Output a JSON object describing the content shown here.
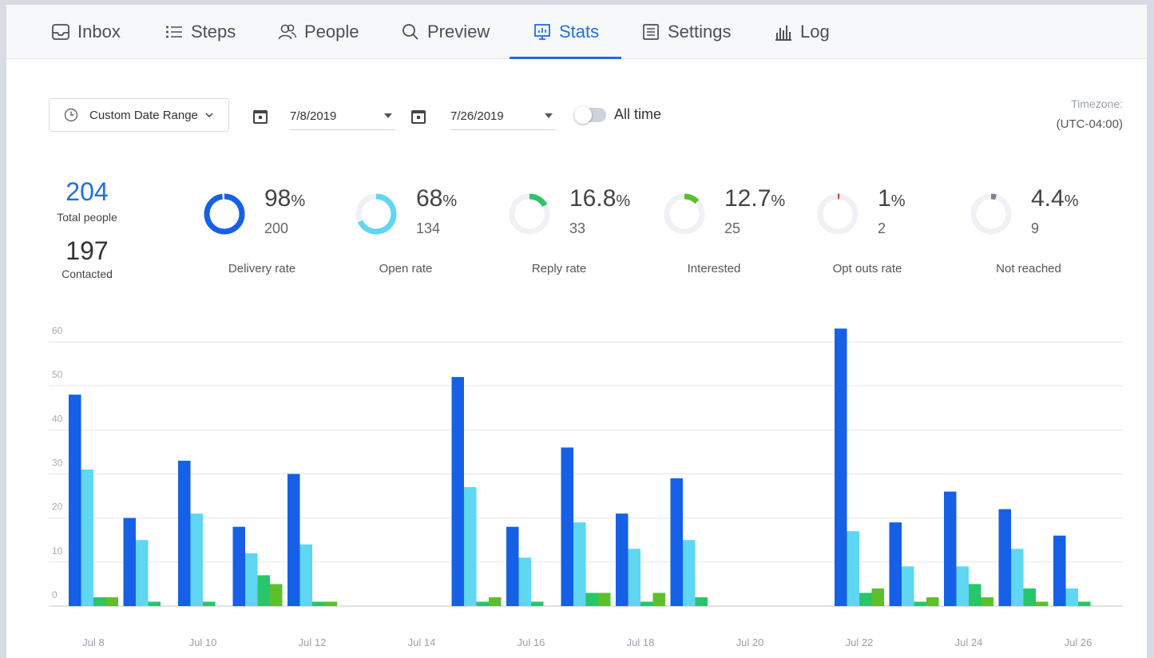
{
  "nav": {
    "tabs": [
      {
        "label": "Inbox",
        "icon": "inbox-icon"
      },
      {
        "label": "Steps",
        "icon": "list-icon"
      },
      {
        "label": "People",
        "icon": "people-icon"
      },
      {
        "label": "Preview",
        "icon": "search-icon"
      },
      {
        "label": "Stats",
        "icon": "stats-icon",
        "active": true
      },
      {
        "label": "Settings",
        "icon": "settings-list-icon"
      },
      {
        "label": "Log",
        "icon": "bar-chart-icon"
      }
    ]
  },
  "filters": {
    "range_label": "Custom Date Range",
    "start_date": "7/8/2019",
    "end_date": "7/26/2019",
    "all_time_label": "All time",
    "all_time_on": false,
    "timezone_label": "Timezone:",
    "timezone_value": "(UTC-04:00)"
  },
  "summary": {
    "total_people": "204",
    "total_people_label": "Total people",
    "contacted": "197",
    "contacted_label": "Contacted"
  },
  "metrics": [
    {
      "pct": "98",
      "unit": "%",
      "count": "200",
      "label": "Delivery rate",
      "fraction": 0.98,
      "color": "#1560e6"
    },
    {
      "pct": "68",
      "unit": "%",
      "count": "134",
      "label": "Open rate",
      "fraction": 0.68,
      "color": "#5fd6f2"
    },
    {
      "pct": "16.8",
      "unit": "%",
      "count": "33",
      "label": "Reply rate",
      "fraction": 0.168,
      "color": "#29c56a"
    },
    {
      "pct": "12.7",
      "unit": "%",
      "count": "25",
      "label": "Interested",
      "fraction": 0.127,
      "color": "#5cbf2e"
    },
    {
      "pct": "1",
      "unit": "%",
      "count": "2",
      "label": "Opt outs rate",
      "fraction": 0.01,
      "color": "#e0334a"
    },
    {
      "pct": "4.4",
      "unit": "%",
      "count": "9",
      "label": "Not reached",
      "fraction": 0.044,
      "color": "#7d8590"
    }
  ],
  "chart_data": {
    "type": "bar",
    "categories": [
      "Jul 8",
      "Jul 9",
      "Jul 10",
      "Jul 11",
      "Jul 12",
      "Jul 13",
      "Jul 14",
      "Jul 15",
      "Jul 16",
      "Jul 17",
      "Jul 18",
      "Jul 19",
      "Jul 20",
      "Jul 21",
      "Jul 22",
      "Jul 23",
      "Jul 24",
      "Jul 25",
      "Jul 26"
    ],
    "tick_labels": [
      "Jul 8",
      "Jul 10",
      "Jul 12",
      "Jul 14",
      "Jul 16",
      "Jul 18",
      "Jul 20",
      "Jul 22",
      "Jul 24",
      "Jul 26"
    ],
    "series": [
      {
        "color": "#1560e6",
        "values": [
          48,
          20,
          33,
          18,
          30,
          0,
          0,
          52,
          18,
          36,
          21,
          29,
          0,
          0,
          63,
          19,
          26,
          22,
          16
        ]
      },
      {
        "color": "#5fd6f2",
        "values": [
          31,
          15,
          21,
          12,
          14,
          0,
          0,
          27,
          11,
          19,
          13,
          15,
          0,
          0,
          17,
          9,
          9,
          13,
          4
        ]
      },
      {
        "color": "#29c56a",
        "values": [
          2,
          1,
          1,
          7,
          1,
          0,
          0,
          1,
          1,
          3,
          1,
          2,
          0,
          0,
          3,
          1,
          5,
          4,
          1
        ]
      },
      {
        "color": "#5cbf2e",
        "values": [
          2,
          0,
          0,
          5,
          1,
          0,
          0,
          2,
          0,
          3,
          3,
          0,
          0,
          0,
          4,
          2,
          2,
          1,
          0
        ]
      }
    ],
    "ylim": [
      0,
      60
    ],
    "yticks": [
      0,
      10,
      20,
      30,
      40,
      50,
      60
    ],
    "grid": true,
    "legend": "none"
  }
}
